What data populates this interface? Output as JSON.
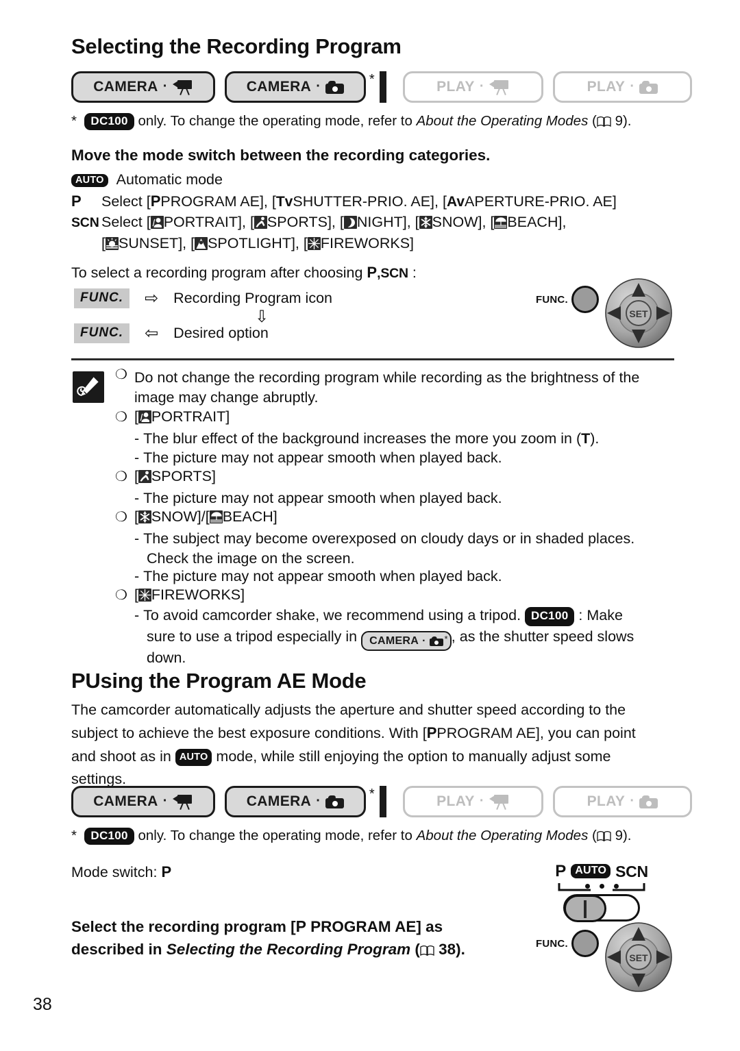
{
  "page": {
    "number": "38"
  },
  "section1": {
    "title": "Selecting the Recording Program",
    "modes": [
      {
        "label": "CAMERA",
        "sep": "·",
        "icon": "camcorder-icon",
        "state": "active",
        "star": false
      },
      {
        "label": "CAMERA",
        "sep": "·",
        "icon": "photo-camera-icon",
        "state": "active",
        "star": true
      },
      {
        "label": "PLAY",
        "sep": "·",
        "icon": "camcorder-icon",
        "state": "inactive",
        "star": false
      },
      {
        "label": "PLAY",
        "sep": "·",
        "icon": "photo-camera-icon",
        "state": "inactive",
        "star": false
      }
    ],
    "footnote": {
      "star": "*",
      "badge": "DC100",
      "text_before": " only. To change the operating mode, refer to ",
      "italic": "About the Operating Modes",
      "paren_open": " (",
      "book_icon": "book-icon",
      "page_ref": "9",
      "paren_close": ").",
      "space": " "
    },
    "instruction": "Move the mode switch between the recording categories.",
    "rows": [
      {
        "marker": "AUTO",
        "marker_type": "badge",
        "text": "Automatic mode"
      },
      {
        "marker": "P",
        "marker_type": "p",
        "text": "Select ["
      },
      {
        "marker": "SCN",
        "marker_type": "scn",
        "text": "Select ["
      }
    ],
    "auto_row_text": "Automatic mode",
    "p_row": {
      "lead": "Select [",
      "p_mark": "P",
      "prog_ae": "PROGRAM AE], [",
      "tv_mark": "Tv",
      "shutter": "SHUTTER-PRIO. AE], [",
      "av_mark": "Av",
      "aperture": "APERTURE-PRIO. AE]"
    },
    "scn_row": {
      "lead": "Select [",
      "items_line1": [
        "PORTRAIT]",
        "SPORTS]",
        "NIGHT]",
        "SNOW]",
        "BEACH]"
      ],
      "items_line2": [
        "SUNSET]",
        "SPOTLIGHT]",
        "FIREWORKS]"
      ],
      "icons_line1": [
        "portrait-icon",
        "sports-icon",
        "night-icon",
        "snow-icon",
        "beach-icon"
      ],
      "icons_line2": [
        "sunset-icon",
        "spotlight-icon",
        "fireworks-icon"
      ]
    },
    "after_choosing": {
      "text": "To select a recording program after choosing ",
      "p_mark": "P",
      "comma": ",",
      "scn_mark": "SCN",
      "colon": " :"
    },
    "steps": [
      {
        "chip": "FUNC.",
        "arrow": "⇨",
        "label": "Recording Program icon"
      },
      {
        "chip": "FUNC.",
        "arrow": "⇦",
        "label": "Desired option"
      }
    ],
    "step_down_arrow": "⇩",
    "joystick": {
      "func_label": "FUNC.",
      "set_label": "SET"
    }
  },
  "notes": {
    "icon": "note-pencil-icon",
    "items": [
      {
        "bullet": "❍",
        "type": "text",
        "lines": [
          "Do not change the recording program while recording as the brightness of the",
          "image may change abruptly."
        ]
      },
      {
        "bullet": "❍",
        "type": "scene",
        "open": "[",
        "icons": [
          "portrait-icon"
        ],
        "labels": [
          "PORTRAIT]"
        ],
        "dashes": [
          {
            "pre": "The blur effect of the background increases the more you zoom in (",
            "bold": "T",
            "post": ")."
          },
          {
            "pre": "The picture may not appear smooth when played back.",
            "bold": "",
            "post": ""
          }
        ]
      },
      {
        "bullet": "❍",
        "type": "scene",
        "open": "[",
        "icons": [
          "sports-icon"
        ],
        "labels": [
          "SPORTS]"
        ],
        "dashes": [
          {
            "pre": "The picture may not appear smooth when played back.",
            "bold": "",
            "post": ""
          }
        ]
      },
      {
        "bullet": "❍",
        "type": "scene2",
        "icons": [
          "snow-icon",
          "beach-icon"
        ],
        "labels": [
          "SNOW]",
          "BEACH]"
        ],
        "joiner": "/[",
        "dashes": [
          {
            "pre": "The subject may become overexposed on cloudy days or in shaded places.",
            "bold": "",
            "post": ""
          },
          {
            "pre": "Check the image on the screen.",
            "bold": "",
            "post": "",
            "cont": true
          },
          {
            "pre": "The picture may not appear smooth when played back.",
            "bold": "",
            "post": ""
          }
        ]
      },
      {
        "bullet": "❍",
        "type": "scene",
        "open": "[",
        "icons": [
          "fireworks-icon"
        ],
        "labels": [
          "FIREWORKS]"
        ],
        "dashes": []
      }
    ],
    "fireworks_dash": {
      "part1": "To avoid camcorder shake, we recommend using a tripod. ",
      "badge": "DC100",
      "part2": " : Make",
      "part3": "sure to use a tripod especially in ",
      "inline_button": {
        "label": "CAMERA",
        "sep": "·",
        "icon": "photo-camera-icon",
        "star": "*"
      },
      "part4": ", as the shutter speed slows",
      "part5": "down."
    }
  },
  "section2": {
    "title_mark": "P",
    "title": "Using the Program AE Mode",
    "body": {
      "line1": "The camcorder automatically adjusts the aperture and shutter speed according to the",
      "line2_pre": "subject to achieve the best exposure conditions. With [",
      "line2_mark": "P",
      "line2_post": "PROGRAM AE], you can point",
      "line3_pre": "and shoot as in ",
      "line3_badge": "AUTO",
      "line3_post": " mode, while still enjoying the option to manually adjust some",
      "line4": "settings."
    },
    "modes": [
      {
        "label": "CAMERA",
        "sep": "·",
        "icon": "camcorder-icon",
        "state": "active",
        "star": false
      },
      {
        "label": "CAMERA",
        "sep": "·",
        "icon": "photo-camera-icon",
        "state": "active",
        "star": true
      },
      {
        "label": "PLAY",
        "sep": "·",
        "icon": "camcorder-icon",
        "state": "inactive",
        "star": false
      },
      {
        "label": "PLAY",
        "sep": "·",
        "icon": "photo-camera-icon",
        "state": "inactive",
        "star": false
      }
    ],
    "footnote": {
      "star": "*",
      "badge": "DC100",
      "text_before": " only. To change the operating mode, refer to ",
      "italic": "About the Operating Modes",
      "paren_open": " (",
      "page_ref": "9",
      "paren_close": ")."
    },
    "mode_switch_label": "Mode switch: ",
    "mode_switch_value": "P",
    "mode_switch_widget": {
      "left_label": "P",
      "center_label": "AUTO",
      "right_label": "SCN",
      "position": "AUTO"
    },
    "final_instruction": {
      "line1_pre": "Select the recording program [",
      "line1_mark": "P",
      "line1_post": " PROGRAM AE] as",
      "line2_pre": "described in ",
      "line2_italic": "Selecting the Recording Program",
      "line2_paren": " (",
      "line2_page": "38",
      "line2_close": ")."
    },
    "joystick": {
      "func_label": "FUNC.",
      "set_label": "SET"
    }
  }
}
